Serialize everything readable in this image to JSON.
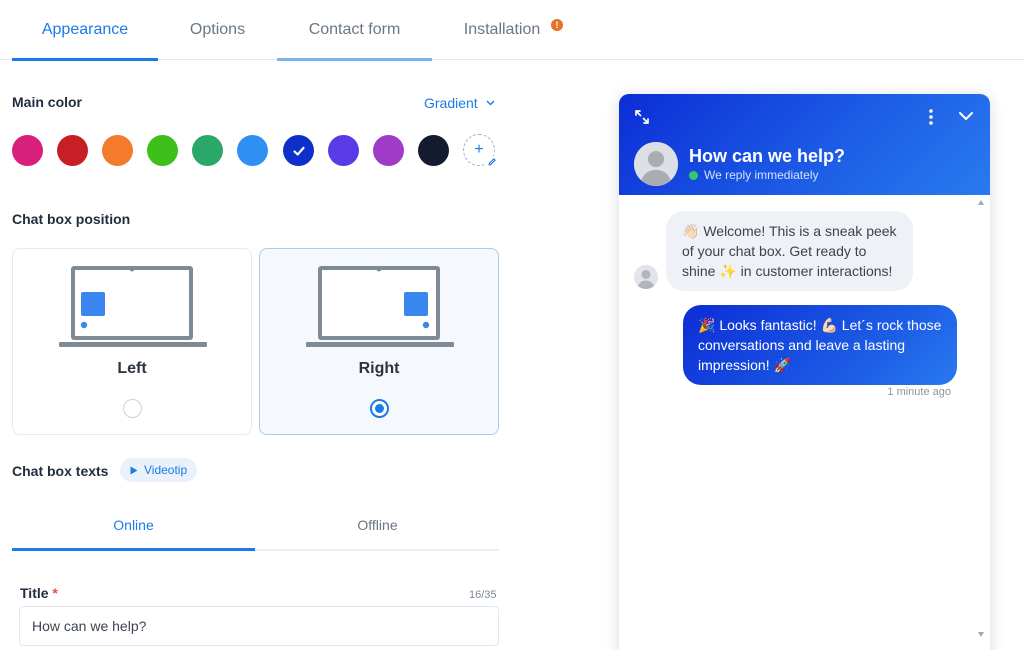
{
  "tabs": [
    {
      "label": "Appearance",
      "active": true
    },
    {
      "label": "Options",
      "active": false
    },
    {
      "label": "Contact form",
      "active": false
    },
    {
      "label": "Installation",
      "active": false,
      "badge": "!"
    }
  ],
  "main_color": {
    "label": "Main color",
    "gradient_label": "Gradient",
    "swatches": [
      "#d81f7b",
      "#c81e25",
      "#f47a2c",
      "#3fbf1a",
      "#2aa86a",
      "#2f8ff2",
      "#0e2fc9",
      "#5b3ae8",
      "#a03bc8",
      "#141b2e"
    ],
    "selected_swatch": "#0e2fc9",
    "add_symbol": "+"
  },
  "position": {
    "label": "Chat box position",
    "options": [
      {
        "label": "Left",
        "selected": false
      },
      {
        "label": "Right",
        "selected": true
      }
    ]
  },
  "texts": {
    "label": "Chat box texts",
    "videotip_label": "Videotip",
    "tabs": [
      {
        "label": "Online",
        "active": true
      },
      {
        "label": "Offline",
        "active": false
      }
    ],
    "title_field": {
      "label": "Title",
      "required_mark": "*",
      "counter": "16/35",
      "value": "How can we help?"
    }
  },
  "preview": {
    "title": "How can we help?",
    "status": "We reply immediately",
    "messages": [
      {
        "from": "agent",
        "text": "👋🏻 Welcome! This is a sneak peek of your chat box. Get ready to shine ✨ in customer interactions!"
      },
      {
        "from": "visitor",
        "text": "🎉 Looks fantastic! 💪🏻 Let´s rock those conversations and leave a lasting impression! 🚀"
      }
    ],
    "time": "1 minute ago"
  },
  "icons": {
    "expand": "expand-icon",
    "more": "more-vertical-icon",
    "collapse": "chevron-down-icon",
    "edit": "pencil-icon",
    "play": "play-icon",
    "check": "check-icon"
  }
}
